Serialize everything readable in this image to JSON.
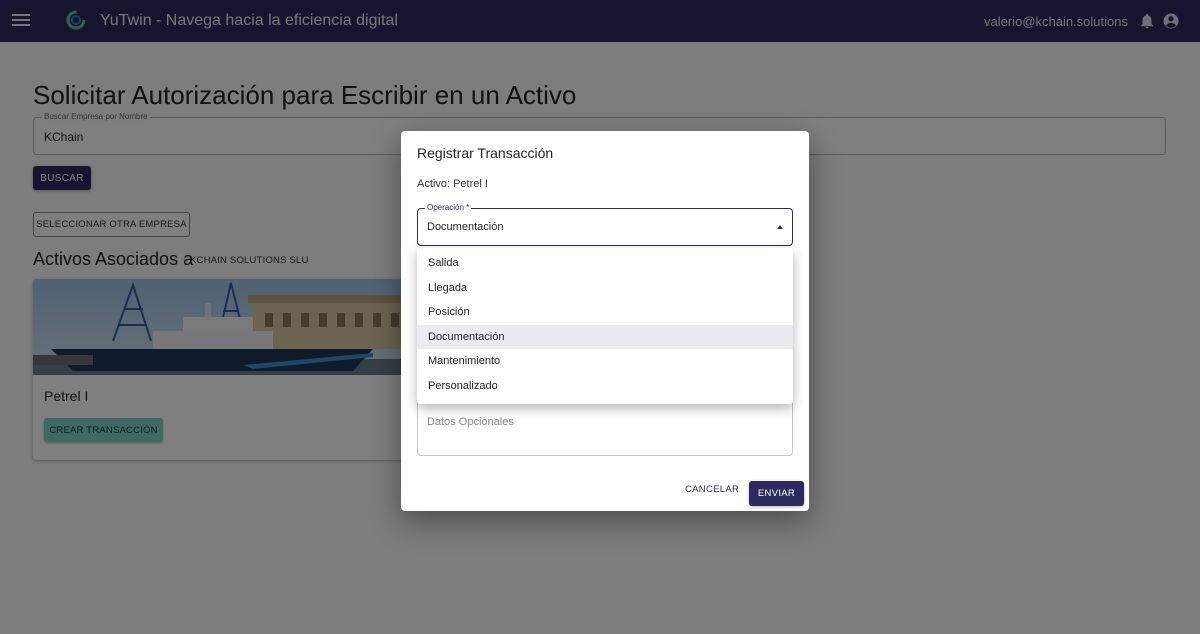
{
  "appbar": {
    "title": "YuTwin - Navega hacia la eficiencia digital",
    "user_email": "valerio@kchain.solutions",
    "colors": {
      "primary": "#2c2a5e",
      "accent": "#7fd4c7"
    }
  },
  "page": {
    "title": "Solicitar Autorización para Escribir en un Activo",
    "search": {
      "label": "Buscar Empresa por Nombre",
      "value": "KChain"
    },
    "buscar_label": "BUSCAR",
    "otra_empresa_label": "SELECCIONAR OTRA EMPRESA",
    "assoc_title": "Activos Asociados a",
    "assoc_company": "KCHAIN SOLUTIONS SLU"
  },
  "card": {
    "name": "Petrel I",
    "create_label": "CREAR TRANSACCIÓN"
  },
  "dialog": {
    "title": "Registrar Transacción",
    "activo": "Activo: Petrel I",
    "operacion_label": "Operación *",
    "operacion_value": "Documentación",
    "datos_placeholder": "Datos Opcionales",
    "cancel_label": "CANCELAR",
    "send_label": "ENVIAR"
  },
  "menu": {
    "items": [
      "Salida",
      "Llegada",
      "Posición",
      "Documentación",
      "Mantenimiento",
      "Personalizado"
    ],
    "selected": "Documentación"
  }
}
